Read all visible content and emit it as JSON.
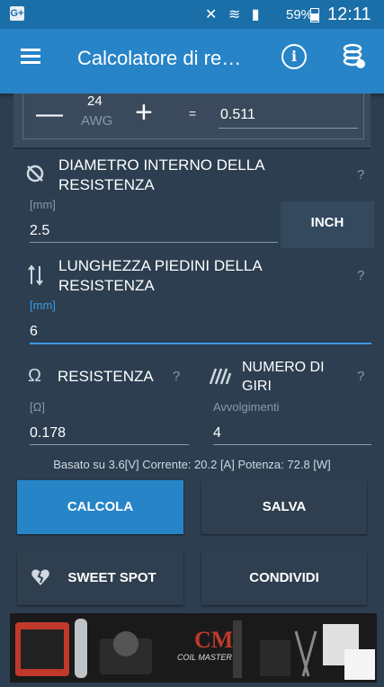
{
  "statusbar": {
    "g_badge": "G+",
    "battery": "59%",
    "time": "12:11"
  },
  "appbar": {
    "title": "Calcolatore di re…"
  },
  "awg": {
    "value": "24",
    "unit": "AWG",
    "equals": "=",
    "result": "0.511"
  },
  "diametro": {
    "label_line1": "DIAMETRO INTERNO DELLA",
    "label_line2": "RESISTENZA",
    "help": "?",
    "unit": "[mm]",
    "value": "2.5",
    "inch_button": "INCH"
  },
  "piedini": {
    "label_line1": "LUNGHEZZA PIEDINI DELLA",
    "label_line2": "RESISTENZA",
    "help": "?",
    "unit": "[mm]",
    "value": "6"
  },
  "resistenza": {
    "symbol": "Ω",
    "label": "RESISTENZA",
    "help": "?",
    "unit": "[Ω]",
    "value": "0.178"
  },
  "giri": {
    "label_line1": "NUMERO DI",
    "label_line2": "GIRI",
    "help": "?",
    "unit": "Avvolgimenti",
    "value": "4"
  },
  "info": "Basato su 3.6[V]  Corrente: 20.2 [A]  Potenza: 72.8 [W]",
  "buttons": {
    "calcola": "CALCOLA",
    "salva": "SALVA",
    "sweet_spot": "SWEET SPOT",
    "condividi": "CONDIVIDI"
  },
  "ad": {
    "brand": "COIL MASTER"
  },
  "colors": {
    "primary": "#2784c7",
    "status_bar": "#1b6fa8",
    "background": "#2c3e50",
    "accent_line": "#3b9be0"
  }
}
